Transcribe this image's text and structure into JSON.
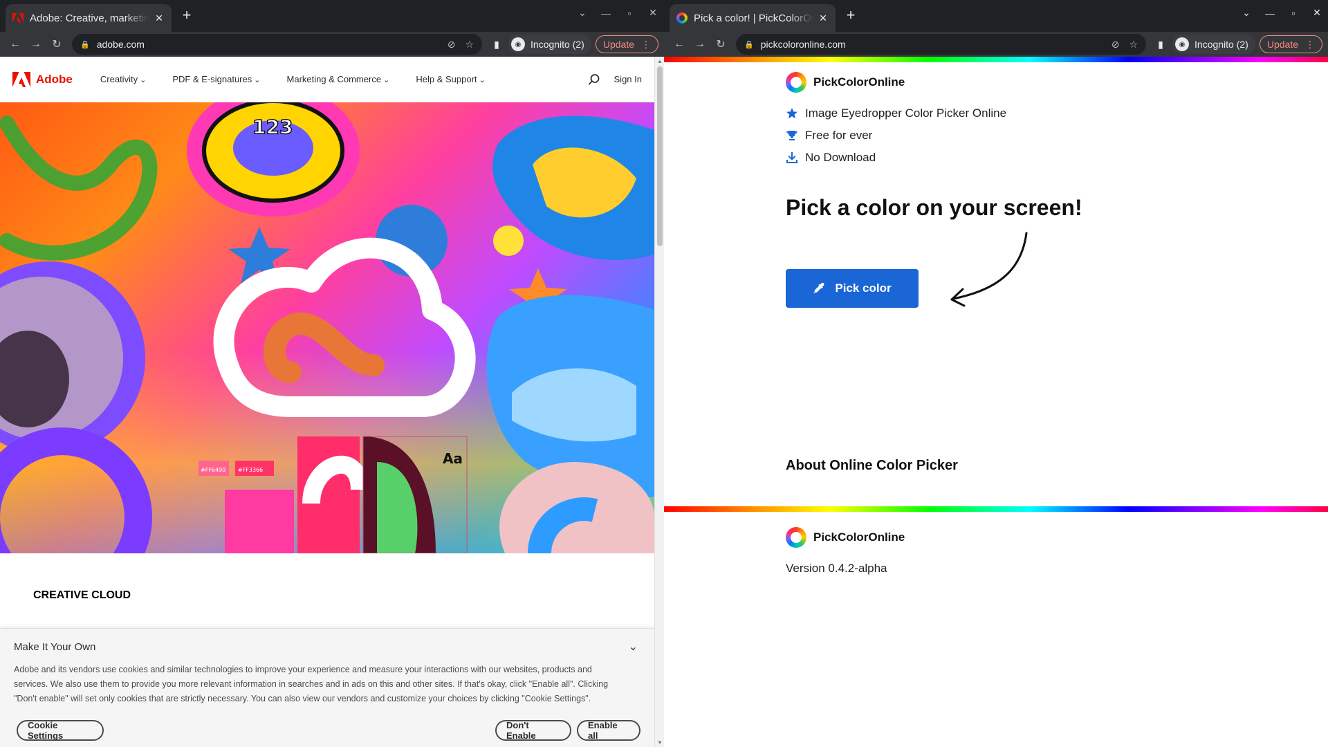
{
  "left": {
    "tab_title": "Adobe: Creative, marketing and document management solutions",
    "url": "adobe.com",
    "incognito_label": "Incognito (2)",
    "update_label": "Update",
    "adobe_brand": "Adobe",
    "nav": [
      "Creativity",
      "PDF & E-signatures",
      "Marketing & Commerce",
      "Help & Support"
    ],
    "sign_in": "Sign In",
    "hero_text": {
      "swatch1": "#FF6490",
      "swatch2": "#FF3366",
      "aa": "Aa",
      "badge": "123"
    },
    "section_label": "CREATIVE CLOUD",
    "cookie": {
      "title": "Make It Your Own",
      "body": "Adobe and its vendors use cookies and similar technologies to improve your experience and measure your interactions with our websites, products and services. We also use them to provide you more relevant information in searches and in ads on this and other sites. If that's okay, click \"Enable all\". Clicking \"Don't enable\" will set only cookies that are strictly necessary. You can also view our vendors and customize your choices by clicking \"Cookie Settings\".",
      "settings_btn": "Cookie Settings",
      "dont_enable_btn": "Don't Enable",
      "enable_all_btn": "Enable all"
    }
  },
  "right": {
    "tab_title": "Pick a color! | PickColorOnline.com",
    "url": "pickcoloronline.com",
    "incognito_label": "Incognito (2)",
    "update_label": "Update",
    "brand": "PickColorOnline",
    "features": [
      "Image Eyedropper Color Picker Online",
      "Free for ever",
      "No Download"
    ],
    "heading": "Pick a color on your screen!",
    "pick_button": "Pick color",
    "about_heading": "About Online Color Picker",
    "footer_brand": "PickColorOnline",
    "version": "Version 0.4.2-alpha"
  },
  "colors": {
    "adobe_red": "#eb1000",
    "pick_blue": "#1a66d6",
    "update_red": "#f28b82"
  }
}
